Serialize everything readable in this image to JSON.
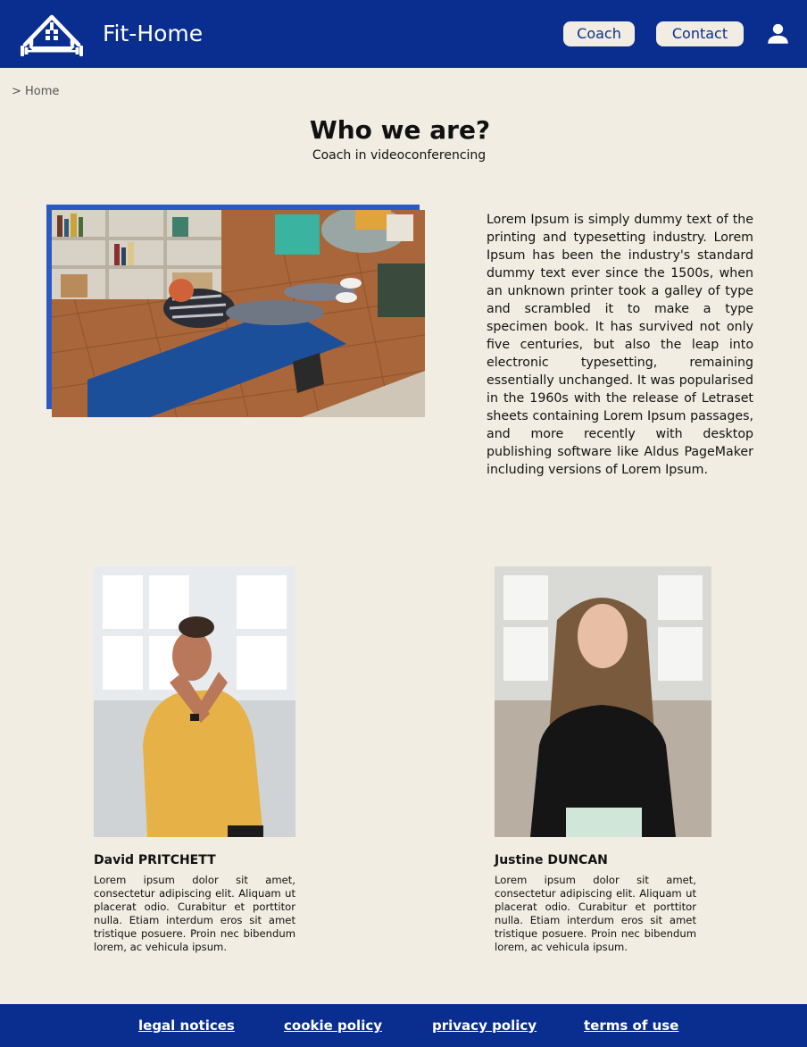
{
  "header": {
    "brand": "Fit-Home",
    "nav": {
      "coach_label": "Coach",
      "contact_label": "Contact"
    },
    "logo_icon": "house-dumbbell-logo",
    "account_icon": "user-icon"
  },
  "breadcrumb": {
    "text": "> Home"
  },
  "hero": {
    "title": "Who we are?",
    "subtitle": "Coach in videoconferencing"
  },
  "intro": {
    "image": "woman-doing-crunches-on-blue-yoga-mat-photo",
    "text": "Lorem Ipsum is simply dummy text of the printing and typesetting industry. Lorem Ipsum has been the industry's standard dummy text ever since the 1500s, when an unknown printer took a galley of type and scrambled it to make a type specimen book. It has survived not only five centuries, but also the leap into electronic typesetting, remaining essentially unchanged. It was popularised in the 1960s with the release of Letraset sheets containing Lorem Ipsum passages, and more recently with desktop publishing software like Aldus PageMaker including versions of Lorem Ipsum."
  },
  "coaches": [
    {
      "name": "David PRITCHETT",
      "image": "man-in-yellow-tank-top-photo",
      "bio": "Lorem ipsum dolor sit amet, consectetur adipiscing elit. Aliquam ut placerat odio. Curabitur et porttitor nulla. Etiam interdum eros sit amet tristique posuere. Proin nec bibendum lorem, ac vehicula ipsum."
    },
    {
      "name": "Justine DUNCAN",
      "image": "woman-in-black-sweater-photo",
      "bio": "Lorem ipsum dolor sit amet, consectetur adipiscing elit. Aliquam ut placerat odio. Curabitur et porttitor nulla. Etiam interdum eros sit amet tristique posuere. Proin nec bibendum lorem, ac vehicula ipsum."
    }
  ],
  "footer": {
    "links": [
      "legal notices",
      "cookie policy",
      "privacy policy",
      "terms of use"
    ]
  },
  "colors": {
    "primary": "#0a2e8f",
    "accent": "#2a5bc4",
    "background": "#f2ede2"
  }
}
